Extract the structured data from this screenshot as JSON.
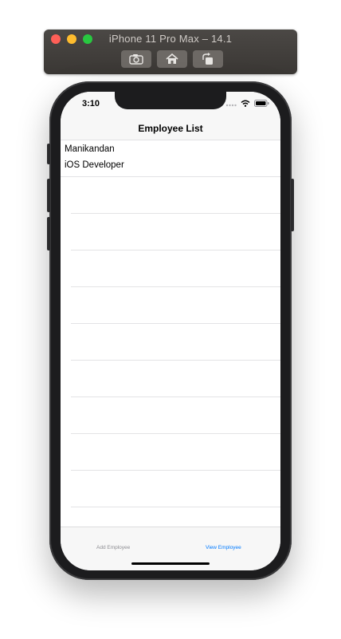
{
  "simulator": {
    "title": "iPhone 11 Pro Max – 14.1",
    "buttons": [
      "screenshot-icon",
      "home-icon",
      "rotate-icon"
    ]
  },
  "status_bar": {
    "time": "3:10",
    "icons": [
      "signal-icon",
      "wifi-icon",
      "battery-icon"
    ]
  },
  "nav": {
    "title": "Employee List"
  },
  "employees": [
    {
      "name": "Manikandan",
      "role": "iOS Developer"
    }
  ],
  "tab_bar": {
    "add_label": "Add Employee",
    "view_label": "View Employee",
    "active_color": "#007aff",
    "inactive_color": "#8e8e93"
  }
}
